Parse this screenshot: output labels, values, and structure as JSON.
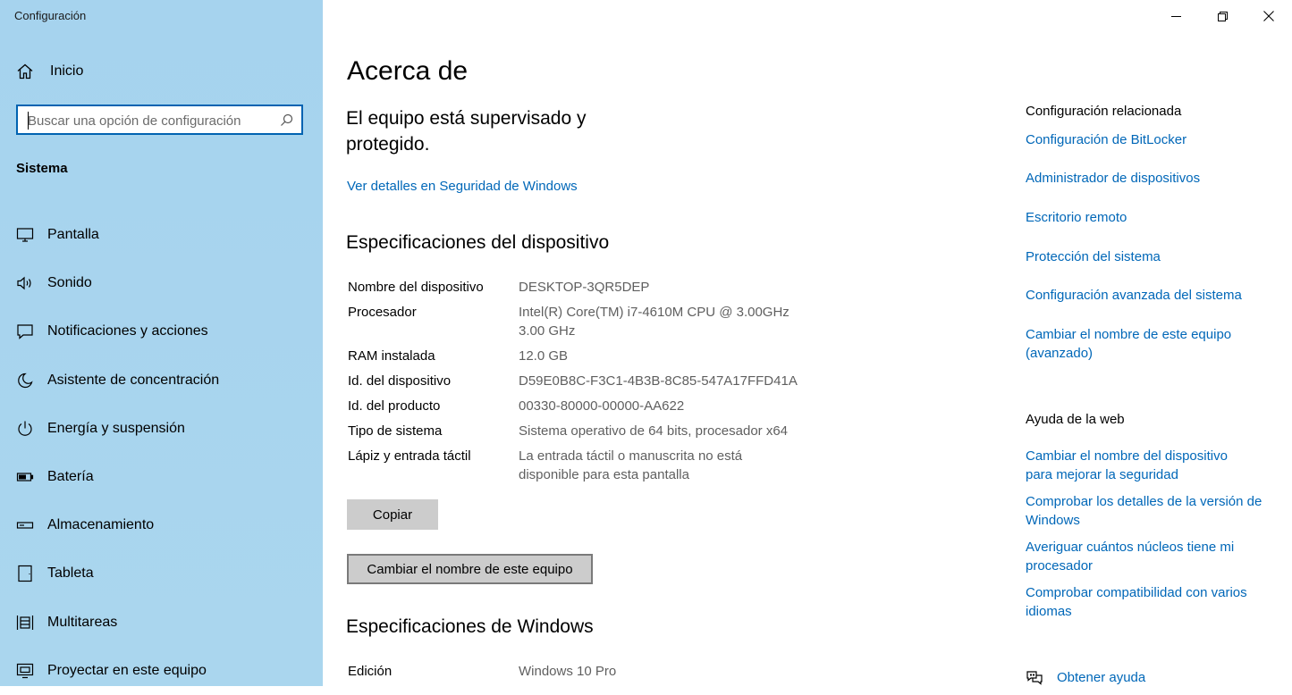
{
  "window": {
    "title": "Configuración"
  },
  "sidebar": {
    "home_label": "Inicio",
    "search": {
      "placeholder": "Buscar una opción de configuración"
    },
    "section_label": "Sistema",
    "items": [
      {
        "label": "Pantalla",
        "icon": "monitor-icon"
      },
      {
        "label": "Sonido",
        "icon": "speaker-icon"
      },
      {
        "label": "Notificaciones y acciones",
        "icon": "notification-icon"
      },
      {
        "label": "Asistente de concentración",
        "icon": "moon-icon"
      },
      {
        "label": "Energía y suspensión",
        "icon": "power-icon"
      },
      {
        "label": "Batería",
        "icon": "battery-icon"
      },
      {
        "label": "Almacenamiento",
        "icon": "storage-icon"
      },
      {
        "label": "Tableta",
        "icon": "tablet-icon"
      },
      {
        "label": "Multitareas",
        "icon": "multitask-icon"
      },
      {
        "label": "Proyectar en este equipo",
        "icon": "project-icon"
      }
    ]
  },
  "main": {
    "title": "Acerca de",
    "security_text": "El equipo está supervisado y protegido.",
    "security_link": "Ver detalles en Seguridad de Windows",
    "device_specs": {
      "heading": "Especificaciones del dispositivo",
      "rows": [
        {
          "key": "Nombre del dispositivo",
          "value": "DESKTOP-3QR5DEP"
        },
        {
          "key": "Procesador",
          "value": "Intel(R) Core(TM) i7-4610M CPU @ 3.00GHz 3.00 GHz"
        },
        {
          "key": "RAM instalada",
          "value": "12.0 GB"
        },
        {
          "key": "Id. del dispositivo",
          "value": "D59E0B8C-F3C1-4B3B-8C85-547A17FFD41A"
        },
        {
          "key": "Id. del producto",
          "value": "00330-80000-00000-AA622"
        },
        {
          "key": "Tipo de sistema",
          "value": "Sistema operativo de 64 bits, procesador x64"
        },
        {
          "key": "Lápiz y entrada táctil",
          "value": "La entrada táctil o manuscrita no está disponible para esta pantalla"
        }
      ],
      "copy_button": "Copiar",
      "rename_button": "Cambiar el nombre de este equipo"
    },
    "windows_specs": {
      "heading": "Especificaciones de Windows",
      "rows": [
        {
          "key": "Edición",
          "value": "Windows 10 Pro"
        }
      ]
    }
  },
  "related": {
    "heading": "Configuración relacionada",
    "links": [
      "Configuración de BitLocker",
      "Administrador de dispositivos",
      "Escritorio remoto",
      "Protección del sistema",
      "Configuración avanzada del sistema",
      "Cambiar el nombre de este equipo (avanzado)"
    ]
  },
  "web_help": {
    "heading": "Ayuda de la web",
    "links": [
      "Cambiar el nombre del dispositivo para mejorar la seguridad",
      "Comprobar los detalles de la versión de Windows",
      "Averiguar cuántos núcleos tiene mi procesador",
      "Comprobar compatibilidad con varios idiomas"
    ],
    "get_help": "Obtener ayuda"
  },
  "colors": {
    "accent": "#0067b8",
    "sidebar_bg": "#a6d3ee",
    "button_bg": "#cccccc"
  }
}
